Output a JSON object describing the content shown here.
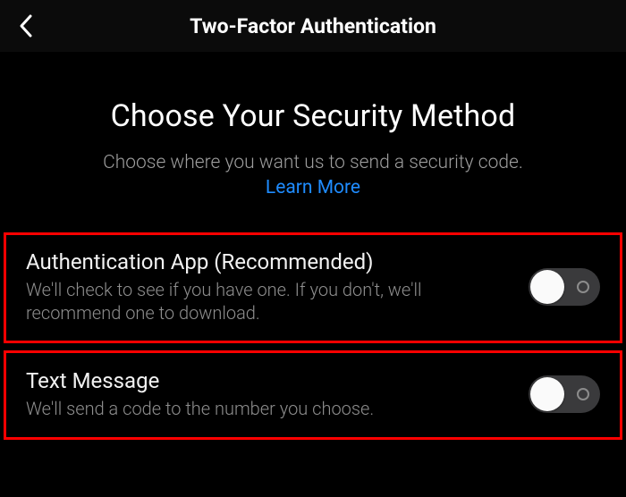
{
  "navbar": {
    "title": "Two-Factor Authentication"
  },
  "hero": {
    "heading": "Choose Your Security Method",
    "subtext": "Choose where you want us to send a security code.",
    "learn_more": "Learn More"
  },
  "options": [
    {
      "title": "Authentication App (Recommended)",
      "desc": "We'll check to see if you have one. If you don't, we'll recommend one to download.",
      "toggle_on": false
    },
    {
      "title": "Text Message",
      "desc": "We'll send a code to the number you choose.",
      "toggle_on": false
    }
  ],
  "colors": {
    "link": "#1f8cff",
    "highlight_border": "#ff0000",
    "toggle_track": "#3a3a3c"
  }
}
